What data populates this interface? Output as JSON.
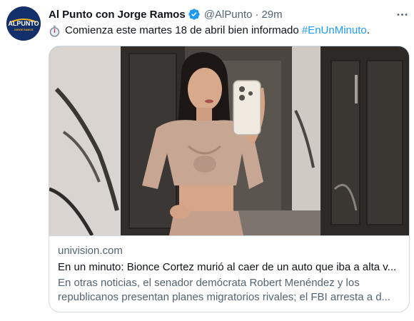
{
  "tweet": {
    "display_name": "Al Punto con Jorge Ramos",
    "handle": "@AlPunto",
    "separator": "·",
    "time": "29m",
    "text_main": "Comienza este martes 18 de abril bien informado ",
    "hashtag": "#EnUnMinuto",
    "text_end": ".",
    "icons": [
      "avatar-logo",
      "verified-badge-icon",
      "stopwatch-icon",
      "more-options-icon"
    ],
    "avatar_logo_text": "ALPUNTO",
    "avatar_logo_sub": "JORGE RAMOS",
    "colors": {
      "accent": "#1d9bf0",
      "muted": "#536471",
      "border": "#cfd9de",
      "text": "#0f1419"
    }
  },
  "card": {
    "domain": "univision.com",
    "title": "En un minuto: Bionce Cortez murió al caer de un auto que iba a alta v...",
    "description_line1": "En otras noticias, el senador demócrata Robert Menéndez y los",
    "description_line2": "republicanos presentan planes migratorios rivales; el FBI arresta a d..."
  }
}
